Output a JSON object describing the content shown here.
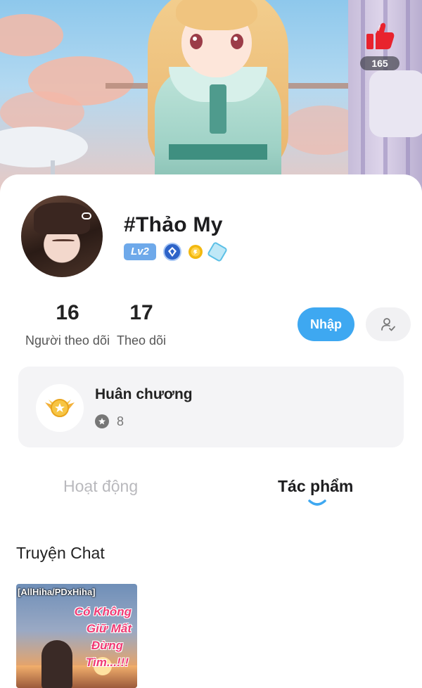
{
  "banner": {
    "like_count": "165"
  },
  "profile": {
    "name": "#Thảo My",
    "level": "Lv2",
    "stats": [
      {
        "value": "16",
        "label": "Người theo dõi"
      },
      {
        "value": "17",
        "label": "Theo dõi"
      }
    ],
    "enter_button": "Nhập"
  },
  "medals": {
    "title": "Huân chương",
    "count": "8"
  },
  "tabs": [
    {
      "label": "Hoạt động",
      "active": false
    },
    {
      "label": "Tác phẩm",
      "active": true
    }
  ],
  "works": {
    "section_title": "Truyện Chat",
    "items": [
      {
        "tag": "[AllHiha/PDxHiha]",
        "title_lines": [
          "Có Không",
          "Giữ Mất",
          "Đừng",
          "Tìm...!!!"
        ]
      }
    ]
  },
  "colors": {
    "accent": "#3ea8f1",
    "like": "#e8232e",
    "title_pink": "#f03a74",
    "level_badge": "#6ea9ea"
  },
  "icons": {
    "like": "thumbs-up-icon",
    "follow": "person-check-icon",
    "medal": "winged-medal-icon",
    "medal_count": "star-icon"
  }
}
